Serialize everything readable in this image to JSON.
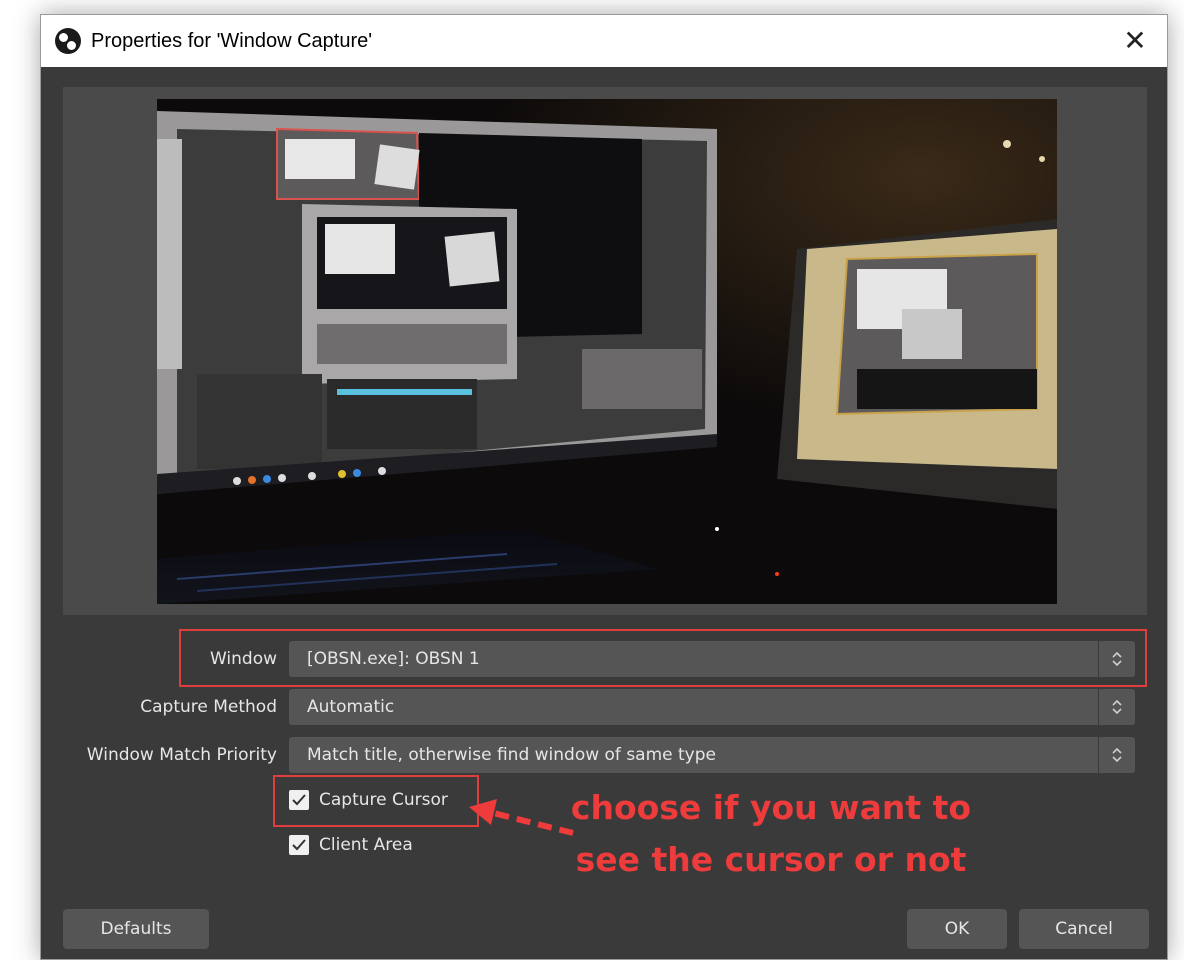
{
  "window": {
    "title": "Properties for 'Window Capture'",
    "close_glyph": "✕",
    "icon": "obs-logo-icon"
  },
  "form": {
    "window": {
      "label": "Window",
      "value": "[OBSN.exe]: OBSN 1"
    },
    "capture_method": {
      "label": "Capture Method",
      "value": "Automatic"
    },
    "match_priority": {
      "label": "Window Match Priority",
      "value": "Match title, otherwise find window of same type"
    },
    "capture_cursor": {
      "label": "Capture Cursor",
      "checked": true
    },
    "client_area": {
      "label": "Client Area",
      "checked": true
    }
  },
  "annotation": {
    "line1": "choose if you want to",
    "line2": "see the cursor or not",
    "color": "#ee3b3b"
  },
  "buttons": {
    "defaults": "Defaults",
    "ok": "OK",
    "cancel": "Cancel"
  },
  "colors": {
    "dialog_bg": "#3a3a3a",
    "field_bg": "#555556",
    "highlight": "#e23d3d"
  }
}
